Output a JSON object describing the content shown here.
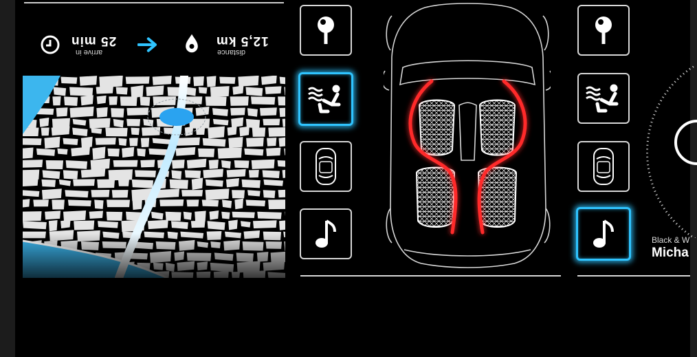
{
  "trip": {
    "time_value": "25 min",
    "time_label": "arrive in",
    "distance_value": "12,5 km",
    "distance_label": "distance",
    "time_icon": "clock-icon",
    "arrow_icon": "arrow-right-icon",
    "distance_icon": "drop-location-icon"
  },
  "colors": {
    "accent": "#2fc4ff",
    "seat_heat": "#ff2a2a",
    "background": "#000000",
    "route": "#e8f6ff"
  },
  "left_menu": [
    {
      "id": "navigation",
      "icon": "map-pin-icon",
      "active": false
    },
    {
      "id": "climate",
      "icon": "seat-climate-icon",
      "active": true
    },
    {
      "id": "vehicle",
      "icon": "car-top-icon",
      "active": false
    },
    {
      "id": "music",
      "icon": "music-note-icon",
      "active": false
    }
  ],
  "right_menu": [
    {
      "id": "navigation",
      "icon": "map-pin-icon",
      "active": false
    },
    {
      "id": "climate",
      "icon": "seat-climate-icon",
      "active": false
    },
    {
      "id": "vehicle",
      "icon": "car-top-icon",
      "active": false
    },
    {
      "id": "music",
      "icon": "music-note-icon",
      "active": true
    }
  ],
  "car_view": {
    "seats": 4,
    "heated_zones": [
      "front-left",
      "front-right",
      "rear-left",
      "rear-right"
    ]
  },
  "music": {
    "artist": "Black & W",
    "title": "Micha"
  }
}
